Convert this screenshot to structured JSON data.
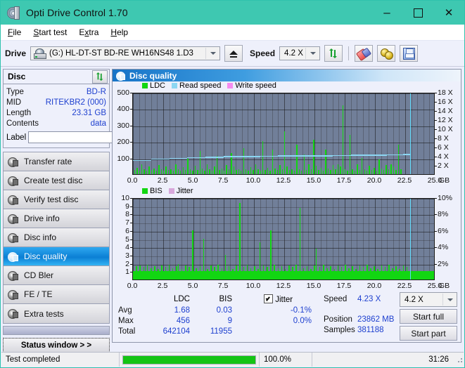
{
  "window": {
    "title": "Opti Drive Control 1.70",
    "icon": "disc-icon",
    "minimize": "–",
    "maximize": "□",
    "close": "✕"
  },
  "menu": {
    "items": [
      {
        "label": "File",
        "accel": "F"
      },
      {
        "label": "Start test",
        "accel": "S"
      },
      {
        "label": "Extra",
        "accel": "x"
      },
      {
        "label": "Help",
        "accel": "H"
      }
    ]
  },
  "toolbar": {
    "drive_label": "Drive",
    "drive_value": "(G:)  HL-DT-ST BD-RE  WH16NS48 1.D3",
    "eject_icon": "eject-icon",
    "speed_label": "Speed",
    "speed_value": "4.2 X",
    "refresh_icon": "refresh-icon",
    "erase_icon": "eraser-icon",
    "tools_icon": "gold-tools-icon",
    "save_icon": "save-icon"
  },
  "disc_panel": {
    "title": "Disc",
    "refresh_icon": "refresh-icon",
    "rows": [
      {
        "key": "Type",
        "value": "BD-R"
      },
      {
        "key": "MID",
        "value": "RITEKBR2 (000)"
      },
      {
        "key": "Length",
        "value": "23.31 GB"
      },
      {
        "key": "Contents",
        "value": "data"
      }
    ],
    "label_key": "Label",
    "label_value": "",
    "label_placeholder": "",
    "disc_icon": "cd-icon"
  },
  "sidebar": {
    "items": [
      {
        "label": "Transfer rate",
        "active": false
      },
      {
        "label": "Create test disc",
        "active": false
      },
      {
        "label": "Verify test disc",
        "active": false
      },
      {
        "label": "Drive info",
        "active": false
      },
      {
        "label": "Disc info",
        "active": false
      },
      {
        "label": "Disc quality",
        "active": true
      },
      {
        "label": "CD Bler",
        "active": false
      },
      {
        "label": "FE / TE",
        "active": false
      },
      {
        "label": "Extra tests",
        "active": false
      }
    ],
    "status_button": "Status window > >"
  },
  "panel": {
    "title": "Disc quality",
    "icon": "disc-quality-icon"
  },
  "chart_data": [
    {
      "type": "bar",
      "name": "top-chart",
      "title": "",
      "xlabel": "GB",
      "ylabel": "",
      "legend": [
        {
          "label": "LDC",
          "color": "#12d612"
        },
        {
          "label": "Read speed",
          "color": "#8cd6f2"
        },
        {
          "label": "Write speed",
          "color": "#f58cf0"
        }
      ],
      "x_ticks": [
        "0.0",
        "2.5",
        "5.0",
        "7.5",
        "10.0",
        "12.5",
        "15.0",
        "17.5",
        "20.0",
        "22.5",
        "25.0"
      ],
      "x_unit": "GB",
      "xlim": [
        0,
        25
      ],
      "y_left_ticks": [
        "100",
        "200",
        "300",
        "400",
        "500"
      ],
      "ylim": [
        0,
        500
      ],
      "y_right_ticks": [
        "2 X",
        "4 X",
        "6 X",
        "8 X",
        "10 X",
        "12 X",
        "14 X",
        "16 X",
        "18 X"
      ],
      "y_right_lim": [
        0,
        18
      ],
      "grid": true,
      "cursor_x": 22.9,
      "series": [
        {
          "name": "LDC",
          "color": "#12d612",
          "x": [
            0.1,
            0.3,
            0.5,
            0.7,
            0.9,
            1.1,
            1.3,
            1.5,
            1.7,
            1.9,
            2.1,
            2.3,
            2.5,
            2.7,
            2.9,
            3.1,
            3.3,
            3.5,
            3.7,
            3.9,
            4.1,
            4.3,
            4.5,
            4.7,
            4.9,
            5.1,
            5.3,
            5.5,
            5.7,
            5.9,
            6.1,
            6.3,
            6.5,
            6.7,
            6.9,
            7.1,
            7.3,
            7.5,
            7.7,
            7.9,
            8.1,
            8.3,
            8.5,
            8.7,
            8.9,
            9.1,
            9.3,
            9.5,
            9.7,
            9.9,
            10.1,
            10.3,
            10.5,
            10.7,
            10.9,
            11.1,
            11.3,
            11.5,
            11.7,
            11.9,
            12.1,
            12.3,
            12.5,
            12.7,
            12.9,
            13.1,
            13.3,
            13.5,
            13.7,
            13.9,
            14.1,
            14.3,
            14.5,
            14.7,
            14.9,
            15.1,
            15.3,
            15.5,
            15.7,
            15.9,
            16.1,
            16.3,
            16.5,
            16.7,
            16.9,
            17.1,
            17.3,
            17.5,
            17.7,
            17.9,
            18.1,
            18.3,
            18.5,
            18.7,
            18.9,
            19.1,
            19.3,
            19.5,
            19.7,
            19.9,
            20.1,
            20.3,
            20.5,
            20.7,
            20.9,
            21.1,
            21.3,
            21.5,
            21.7,
            21.9,
            22.1,
            22.3,
            22.5,
            22.7,
            22.9
          ],
          "values": [
            25,
            40,
            22,
            60,
            30,
            20,
            48,
            25,
            35,
            22,
            55,
            28,
            20,
            45,
            25,
            32,
            20,
            60,
            28,
            22,
            42,
            25,
            95,
            30,
            20,
            50,
            25,
            140,
            35,
            22,
            60,
            28,
            20,
            48,
            110,
            25,
            35,
            22,
            55,
            28,
            130,
            45,
            25,
            32,
            20,
            160,
            28,
            22,
            42,
            25,
            60,
            30,
            20,
            200,
            25,
            38,
            22,
            150,
            35,
            24,
            55,
            28,
            260,
            45,
            25,
            32,
            20,
            180,
            28,
            22,
            120,
            25,
            60,
            30,
            210,
            50,
            25,
            38,
            22,
            150,
            35,
            24,
            55,
            28,
            60,
            45,
            420,
            32,
            20,
            240,
            28,
            22,
            60,
            25,
            100,
            30,
            20,
            50,
            25,
            38,
            22,
            90,
            35,
            24,
            55,
            28,
            60,
            45,
            25,
            180,
            30
          ]
        },
        {
          "name": "Read speed",
          "color": "#8cd6f2",
          "x": [
            0.0,
            1.5,
            3.0,
            4.5,
            6.0,
            7.5,
            9.0,
            10.5,
            12.0,
            13.5,
            15.0,
            16.5,
            18.0,
            19.5,
            21.0,
            22.3,
            22.9
          ],
          "values": [
            3.4,
            3.7,
            3.9,
            4.05,
            4.15,
            4.25,
            4.3,
            4.35,
            4.4,
            4.42,
            4.45,
            4.5,
            4.55,
            4.6,
            4.65,
            4.7,
            4.7
          ]
        }
      ]
    },
    {
      "type": "bar",
      "name": "bottom-chart",
      "title": "",
      "xlabel": "GB",
      "legend": [
        {
          "label": "BIS",
          "color": "#12d612"
        },
        {
          "label": "Jitter",
          "color": "#d8a8dc"
        }
      ],
      "x_ticks": [
        "0.0",
        "2.5",
        "5.0",
        "7.5",
        "10.0",
        "12.5",
        "15.0",
        "17.5",
        "20.0",
        "22.5",
        "25.0"
      ],
      "x_unit": "GB",
      "xlim": [
        0,
        25
      ],
      "y_left_ticks": [
        "1",
        "2",
        "3",
        "4",
        "5",
        "6",
        "7",
        "8",
        "9",
        "10"
      ],
      "ylim": [
        0,
        10
      ],
      "y_right_ticks": [
        "2%",
        "4%",
        "6%",
        "8%",
        "10%"
      ],
      "y_right_lim": [
        0,
        10
      ],
      "grid": true,
      "cursor_x": 22.9,
      "series": [
        {
          "name": "BIS",
          "color": "#12d612",
          "x": [
            0.1,
            0.25,
            0.4,
            0.55,
            0.7,
            0.85,
            1.0,
            1.15,
            1.3,
            1.45,
            1.6,
            1.75,
            1.9,
            2.05,
            2.2,
            2.35,
            2.5,
            2.65,
            2.8,
            2.95,
            3.1,
            3.25,
            3.4,
            3.55,
            3.7,
            3.85,
            4.0,
            4.15,
            4.3,
            4.45,
            4.6,
            4.75,
            4.9,
            5.05,
            5.2,
            5.35,
            5.5,
            5.65,
            5.8,
            5.95,
            6.1,
            6.25,
            6.4,
            6.55,
            6.7,
            6.85,
            7.0,
            7.15,
            7.3,
            7.45,
            7.6,
            7.75,
            7.9,
            8.05,
            8.2,
            8.35,
            8.5,
            8.65,
            8.8,
            8.95,
            9.1,
            9.25,
            9.4,
            9.55,
            9.7,
            9.85,
            10.0,
            10.15,
            10.3,
            10.45,
            10.6,
            10.75,
            10.9,
            11.05,
            11.2,
            11.35,
            11.5,
            11.65,
            11.8,
            11.95,
            12.1,
            12.25,
            12.4,
            12.55,
            12.7,
            12.85,
            13.0,
            13.15,
            13.3,
            13.45,
            13.6,
            13.75,
            13.9,
            14.05,
            14.2,
            14.35,
            14.5,
            14.65,
            14.8,
            14.95,
            15.1,
            15.25,
            15.4,
            15.55,
            15.7,
            15.85,
            16.0,
            16.15,
            16.3,
            16.45,
            16.6,
            16.75,
            16.9,
            17.05,
            17.2,
            17.35,
            17.5,
            17.65,
            17.8,
            17.95,
            18.1,
            18.25,
            18.4,
            18.55,
            18.7,
            18.85,
            19.0,
            19.15,
            19.3,
            19.45,
            19.6,
            19.75,
            19.9,
            20.05,
            20.2,
            20.35,
            20.5,
            20.65,
            20.8,
            20.95,
            21.1,
            21.25,
            21.4,
            21.55,
            21.7,
            21.85,
            22.0,
            22.15,
            22.3,
            22.45,
            22.6,
            22.75,
            22.9
          ],
          "values": [
            1,
            1.6,
            1,
            1.7,
            1,
            1.5,
            1,
            1.8,
            1,
            1.4,
            1,
            1.6,
            1,
            1.3,
            1,
            1.7,
            1,
            1.5,
            1,
            1.8,
            1,
            1.4,
            1,
            1.6,
            1.9,
            1,
            1.3,
            1,
            1.7,
            1,
            1.5,
            1,
            6,
            1,
            1.4,
            1,
            1.6,
            1,
            5,
            1,
            1.3,
            1,
            1.7,
            1,
            1.5,
            1,
            1.8,
            1,
            1.4,
            1,
            3,
            1,
            1.6,
            1,
            1.3,
            1,
            1.7,
            1,
            9.3,
            1,
            1.5,
            1,
            1.8,
            1,
            1.4,
            1,
            1.6,
            1,
            1.3,
            4.5,
            1,
            1.7,
            1,
            1.5,
            1,
            6,
            1,
            1.8,
            1,
            1.4,
            1,
            1.6,
            1,
            1.3,
            1,
            1.7,
            1,
            1.5,
            1,
            1.8,
            1,
            8.7,
            1,
            1.4,
            1,
            1.6,
            1,
            1.3,
            1,
            1.7,
            3.8,
            1,
            1.5,
            1,
            1.8,
            1,
            1.4,
            1,
            1.6,
            1,
            1.3,
            1,
            1.7,
            1,
            1.5,
            1,
            1.8,
            1,
            1.4,
            1,
            1.6,
            1,
            1.3,
            1,
            1.7,
            1,
            1.5,
            1,
            1.8,
            1,
            1.4,
            1,
            1.6,
            1,
            1.3,
            1,
            1.7,
            1,
            1.5,
            1,
            1.8,
            1,
            1.4,
            1,
            1.6,
            1,
            1.3,
            1,
            1.7,
            1,
            1.5,
            1,
            1.8,
            1,
            1.4,
            1.2
          ]
        }
      ]
    }
  ],
  "stats": {
    "headers": [
      "",
      "LDC",
      "BIS"
    ],
    "rows": [
      {
        "label": "Avg",
        "ldc": "1.68",
        "bis": "0.03"
      },
      {
        "label": "Max",
        "ldc": "456",
        "bis": "9"
      },
      {
        "label": "Total",
        "ldc": "642104",
        "bis": "11955"
      }
    ],
    "jitter_label": "Jitter",
    "jitter_checked": true,
    "jitter_avg": "-0.1%",
    "jitter_max": "0.0%"
  },
  "readout": {
    "speed_label": "Speed",
    "speed_value": "4.23 X",
    "speed_select": "4.2 X",
    "position_label": "Position",
    "position_value": "23862 MB",
    "samples_label": "Samples",
    "samples_value": "381188",
    "start_full": "Start full",
    "start_part": "Start part"
  },
  "statusbar": {
    "message": "Test completed",
    "progress_text": "100.0%",
    "progress_value": 100,
    "elapsed": "31:26"
  }
}
